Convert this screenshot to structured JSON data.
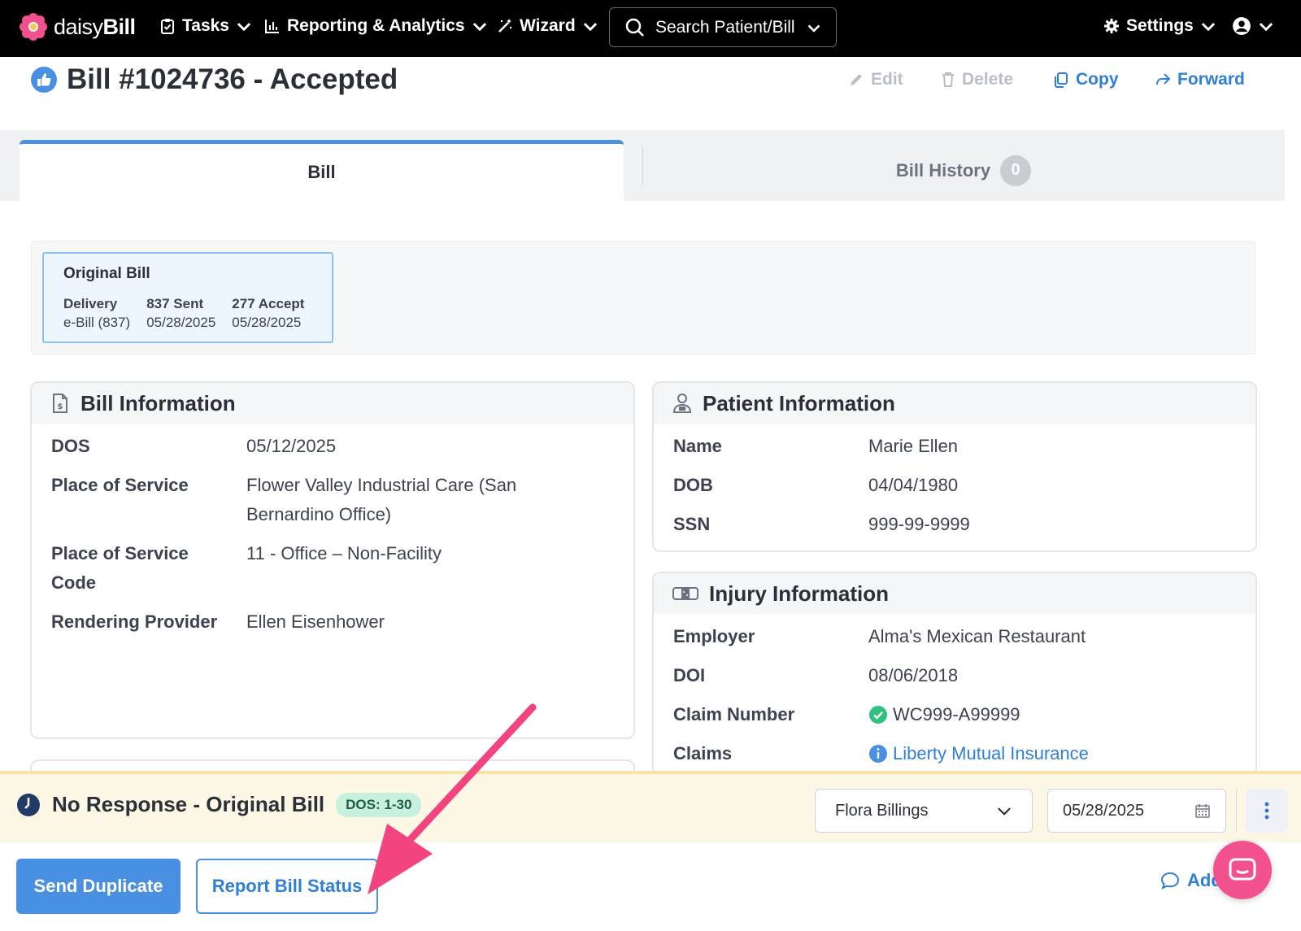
{
  "nav": {
    "logo_text_light": "daisy",
    "logo_text_bold": "Bill",
    "tasks": "Tasks",
    "reporting": "Reporting & Analytics",
    "wizard": "Wizard",
    "search": "Search Patient/Bill",
    "settings": "Settings"
  },
  "header": {
    "title": "Bill #1024736 - Accepted",
    "edit": "Edit",
    "delete": "Delete",
    "copy": "Copy",
    "forward": "Forward"
  },
  "tabs": {
    "bill": "Bill",
    "history": "Bill History",
    "history_count": "0"
  },
  "original_bill": {
    "title": "Original Bill",
    "columns": [
      {
        "label": "Delivery",
        "value": "e-Bill (837)"
      },
      {
        "label": "837 Sent",
        "value": "05/28/2025"
      },
      {
        "label": "277 Accept",
        "value": "05/28/2025"
      }
    ]
  },
  "bill_info": {
    "title": "Bill Information",
    "rows": [
      {
        "label": "DOS",
        "value": "05/12/2025"
      },
      {
        "label": "Place of Service",
        "value": "Flower Valley Industrial Care (San",
        "value2": "Bernardino Office)"
      },
      {
        "label": "Place of Service",
        "label2": "Code",
        "value": "11 - Office – Non-Facility"
      },
      {
        "label": "Rendering Provider",
        "value": "Ellen Eisenhower"
      }
    ]
  },
  "patient_info": {
    "title": "Patient Information",
    "rows": [
      {
        "label": "Name",
        "value": "Marie Ellen"
      },
      {
        "label": "DOB",
        "value": "04/04/1980"
      },
      {
        "label": "SSN",
        "value": "999-99-9999"
      }
    ]
  },
  "injury_info": {
    "title": "Injury Information",
    "rows": [
      {
        "label": "Employer",
        "value": "Alma's Mexican Restaurant"
      },
      {
        "label": "DOI",
        "value": "08/06/2018"
      },
      {
        "label": "Claim Number",
        "value": "WC999-A99999"
      },
      {
        "label": "Claims",
        "value": "Liberty Mutual Insurance"
      }
    ]
  },
  "status": {
    "title": "No Response - Original Bill",
    "badge": "DOS: 1-30",
    "assignee": "Flora Billings",
    "date": "05/28/2025"
  },
  "actions": {
    "send_duplicate": "Send Duplicate",
    "report_status": "Report Bill Status",
    "add_note": "Add Note"
  },
  "colors": {
    "accent": "#4a90e2",
    "annotation_arrow": "#f2457f",
    "status_bar": "#fdf7e6"
  }
}
